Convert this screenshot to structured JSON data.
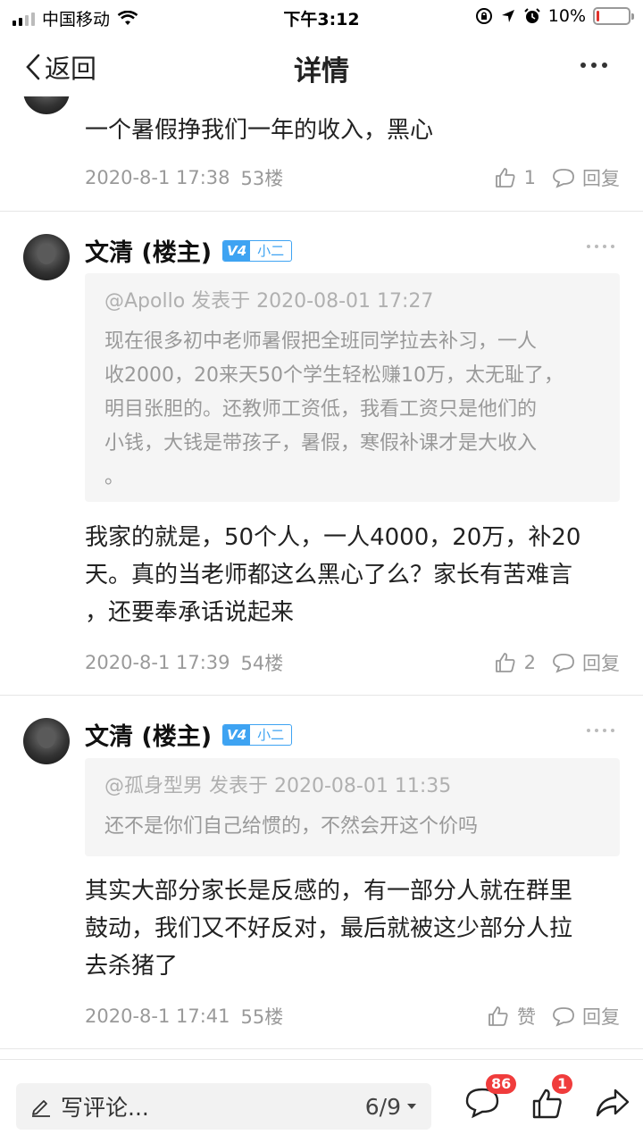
{
  "status_bar": {
    "carrier": "中国移动",
    "time": "下午3:12",
    "battery_pct": "10%",
    "battery_level": 0.1
  },
  "nav": {
    "back_label": "返回",
    "title": "详情"
  },
  "posts": [
    {
      "body": "一个暑假挣我们一年的收入，黑心",
      "date": "2020-8-1 17:38",
      "floor": "53楼",
      "likes": "1",
      "reply_label": "回复"
    },
    {
      "author": "文清 (楼主)",
      "level": "V4",
      "rank": "小二",
      "quote_head": "@Apollo 发表于 2020-08-01 17:27",
      "quote_lines": [
        "现在很多初中老师暑假把全班同学拉去补习，一人",
        "收2000，20来天50个学生轻松赚10万，太无耻了，",
        "明目张胆的。还教师工资低，我看工资只是他们的",
        "小钱，大钱是带孩子，暑假，寒假补课才是大收入",
        "。"
      ],
      "body_lines": [
        "我家的就是，50个人，一人4000，20万，补20",
        "天。真的当老师都这么黑心了么？家长有苦难言",
        "，还要奉承话说起来"
      ],
      "date": "2020-8-1 17:39",
      "floor": "54楼",
      "likes": "2",
      "reply_label": "回复"
    },
    {
      "author": "文清 (楼主)",
      "level": "V4",
      "rank": "小二",
      "quote_head": "@孤身型男 发表于 2020-08-01 11:35",
      "quote_lines": [
        "还不是你们自己给惯的，不然会开这个价吗"
      ],
      "body_lines": [
        "其实大部分家长是反感的，有一部分人就在群里",
        "鼓动，我们又不好反对，最后就被这少部分人拉",
        "去杀猪了"
      ],
      "date": "2020-8-1 17:41",
      "floor": "55楼",
      "likes": "赞",
      "reply_label": "回复"
    }
  ],
  "bottom_bar": {
    "comment_placeholder": "写评论...",
    "page_indicator": "6/9",
    "comment_count": "86",
    "like_count": "1"
  }
}
